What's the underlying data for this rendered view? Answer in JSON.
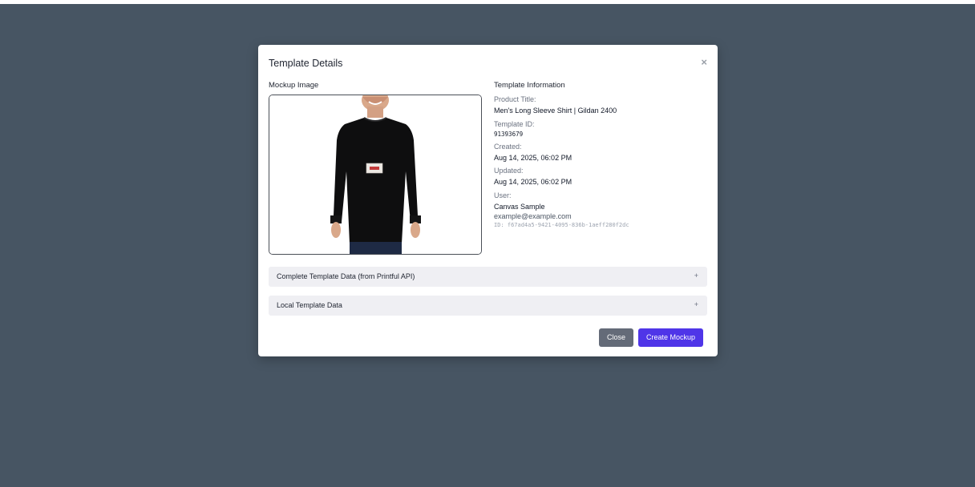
{
  "modal": {
    "title": "Template Details",
    "close_glyph": "×",
    "mockup_label": "Mockup Image",
    "info_label": "Template Information"
  },
  "info": {
    "product_title_label": "Product Title:",
    "product_title": "Men's Long Sleeve Shirt | Gildan 2400",
    "template_id_label": "Template ID:",
    "template_id": "91393679",
    "created_label": "Created:",
    "created": "Aug 14, 2025, 06:02 PM",
    "updated_label": "Updated:",
    "updated": "Aug 14, 2025, 06:02 PM",
    "user_label": "User:",
    "user_name": "Canvas Sample",
    "user_email": "example@example.com",
    "user_id": "ID: f67ad4a5-9421-4095-836b-1aeff280f2dc"
  },
  "accordions": [
    {
      "label": "Complete Template Data (from Printful API)",
      "toggle": "+"
    },
    {
      "label": "Local Template Data",
      "toggle": "+"
    }
  ],
  "buttons": {
    "close": "Close",
    "create": "Create Mockup"
  },
  "colors": {
    "backdrop": "#475563",
    "primary": "#4f35e8",
    "secondary": "#646b78"
  },
  "icons": {
    "close": "close-icon",
    "mockup": "long-sleeve-shirt-photo"
  }
}
